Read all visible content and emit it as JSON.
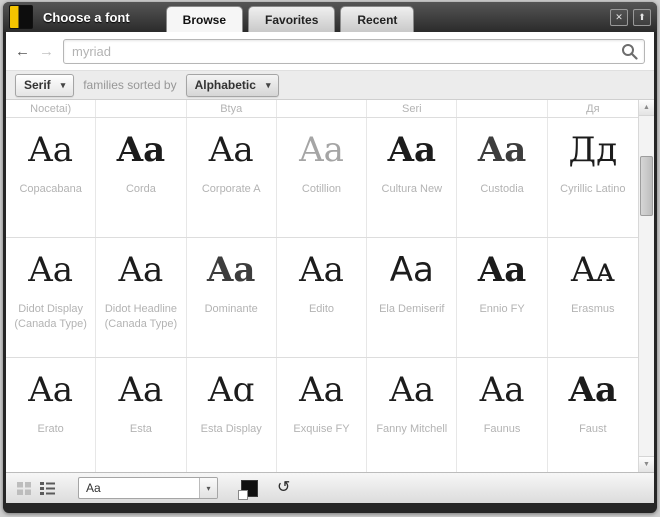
{
  "window": {
    "title": "Choose a font",
    "tabs": [
      {
        "label": "Browse",
        "active": true
      },
      {
        "label": "Favorites",
        "active": false
      },
      {
        "label": "Recent",
        "active": false
      }
    ],
    "controls": {
      "close": "✕",
      "popout": "⬆"
    }
  },
  "icons": {
    "back_arrow": "←",
    "forward_arrow": "→",
    "caret_down": "▾",
    "scroll_up": "▲",
    "scroll_down": "▼",
    "reset_colors": "↻"
  },
  "nav": {
    "search": {
      "value": "",
      "placeholder": "myriad"
    }
  },
  "filters": {
    "category_value": "Serif",
    "sorted_by_label": "families sorted by",
    "sort_value": "Alphabetic"
  },
  "grid": {
    "clipped_row": [
      "Nocetai)",
      "",
      "Btya",
      "",
      "Seri",
      "",
      "Дя"
    ],
    "rows": [
      [
        {
          "name": "Copacabana",
          "preview": "Aa",
          "style": ""
        },
        {
          "name": "Corda",
          "preview": "Aa",
          "style": "bold"
        },
        {
          "name": "Corporate A",
          "preview": "Aa",
          "style": ""
        },
        {
          "name": "Cotillion",
          "preview": "Aa",
          "style": "muted"
        },
        {
          "name": "Cultura New",
          "preview": "Aa",
          "style": "bold"
        },
        {
          "name": "Custodia",
          "preview": "Aa",
          "style": "semi"
        },
        {
          "name": "Cyrillic Latino",
          "preview": "Дд",
          "style": ""
        }
      ],
      [
        {
          "name": "Didot Display (Canada Type)",
          "preview": "Aa",
          "style": ""
        },
        {
          "name": "Didot Headline (Canada Type)",
          "preview": "Aa",
          "style": ""
        },
        {
          "name": "Dominante",
          "preview": "Aa",
          "style": "semi"
        },
        {
          "name": "Edito",
          "preview": "Aa",
          "style": ""
        },
        {
          "name": "Ela Demiserif",
          "preview": "Aa",
          "style": "sans"
        },
        {
          "name": "Ennio FY",
          "preview": "Aa",
          "style": "bold"
        },
        {
          "name": "Erasmus",
          "preview": "Aᴀ",
          "style": ""
        }
      ],
      [
        {
          "name": "Erato",
          "preview": "Aa",
          "style": ""
        },
        {
          "name": "Esta",
          "preview": "Aa",
          "style": ""
        },
        {
          "name": "Esta Display",
          "preview": "Aɑ",
          "style": ""
        },
        {
          "name": "Exquise FY",
          "preview": "Aa",
          "style": ""
        },
        {
          "name": "Fanny Mitchell",
          "preview": "Aa",
          "style": ""
        },
        {
          "name": "Faunus",
          "preview": "Aa",
          "style": ""
        },
        {
          "name": "Faust",
          "preview": "Aa",
          "style": "bold"
        }
      ]
    ]
  },
  "footer": {
    "preview_select_value": "Aa"
  },
  "colors": {
    "accent_yellow": "#f5c400",
    "header_dark": "#2b2b2b",
    "font_label_gray": "#b3b3b3"
  }
}
